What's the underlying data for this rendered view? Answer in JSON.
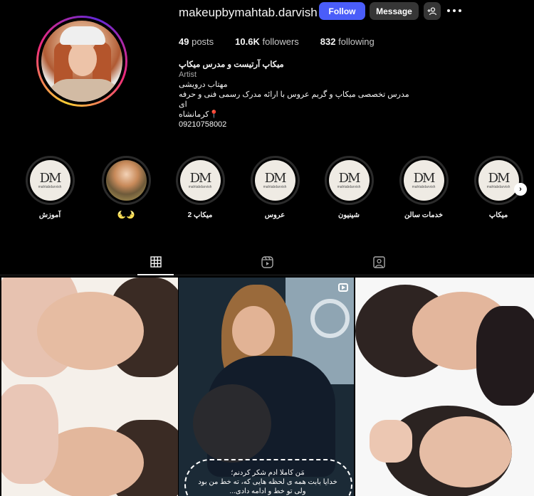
{
  "profile": {
    "username": "makeupbymahtab.darvish",
    "follow_label": "Follow",
    "message_label": "Message",
    "stats": {
      "posts_value": "49",
      "posts_label": "posts",
      "followers_value": "10.6K",
      "followers_label": "followers",
      "following_value": "832",
      "following_label": "following"
    },
    "bio": {
      "full_name": "میکاپ آرتیست و مدرس میکاپ",
      "category": "Artist",
      "line1": "مهتاب درویشی",
      "line2": "مدرس تخصصی میکاپ و گریم عروس با ارائه مدرک رسمی فنی و حرفه ای",
      "line3": "📍کرمانشاه",
      "phone": "09210758002"
    }
  },
  "highlights": [
    {
      "label": "آموزش",
      "cover": "monogram"
    },
    {
      "label": "🌜🌛",
      "cover": "photo"
    },
    {
      "label": "میکاپ 2",
      "cover": "monogram"
    },
    {
      "label": "عروس",
      "cover": "monogram"
    },
    {
      "label": "شینیون",
      "cover": "monogram"
    },
    {
      "label": "خدمات سالن",
      "cover": "monogram"
    },
    {
      "label": "میکاپ",
      "cover": "monogram"
    }
  ],
  "highlight_monogram": "DM",
  "highlight_brand": "mahtabdarvish",
  "tabs": [
    {
      "name": "posts",
      "icon": "grid-icon",
      "active": true
    },
    {
      "name": "reels",
      "icon": "reels-icon",
      "active": false
    },
    {
      "name": "tagged",
      "icon": "tagged-icon",
      "active": false
    }
  ],
  "posts": [
    {
      "kind": "photo"
    },
    {
      "kind": "reel",
      "caption_line1": "مَن کاملا ادم شکر کردنم؛",
      "caption_line2": "خدایا بابت همه ی لحظه هایی که، ته خط من بود",
      "caption_line3": "ولی تو خط و ادامه دادی..."
    },
    {
      "kind": "photo"
    }
  ],
  "colors": {
    "background": "#000000",
    "follow_button": "#4a5df9",
    "secondary_button": "#363636",
    "muted_text": "#a8a8a8"
  }
}
